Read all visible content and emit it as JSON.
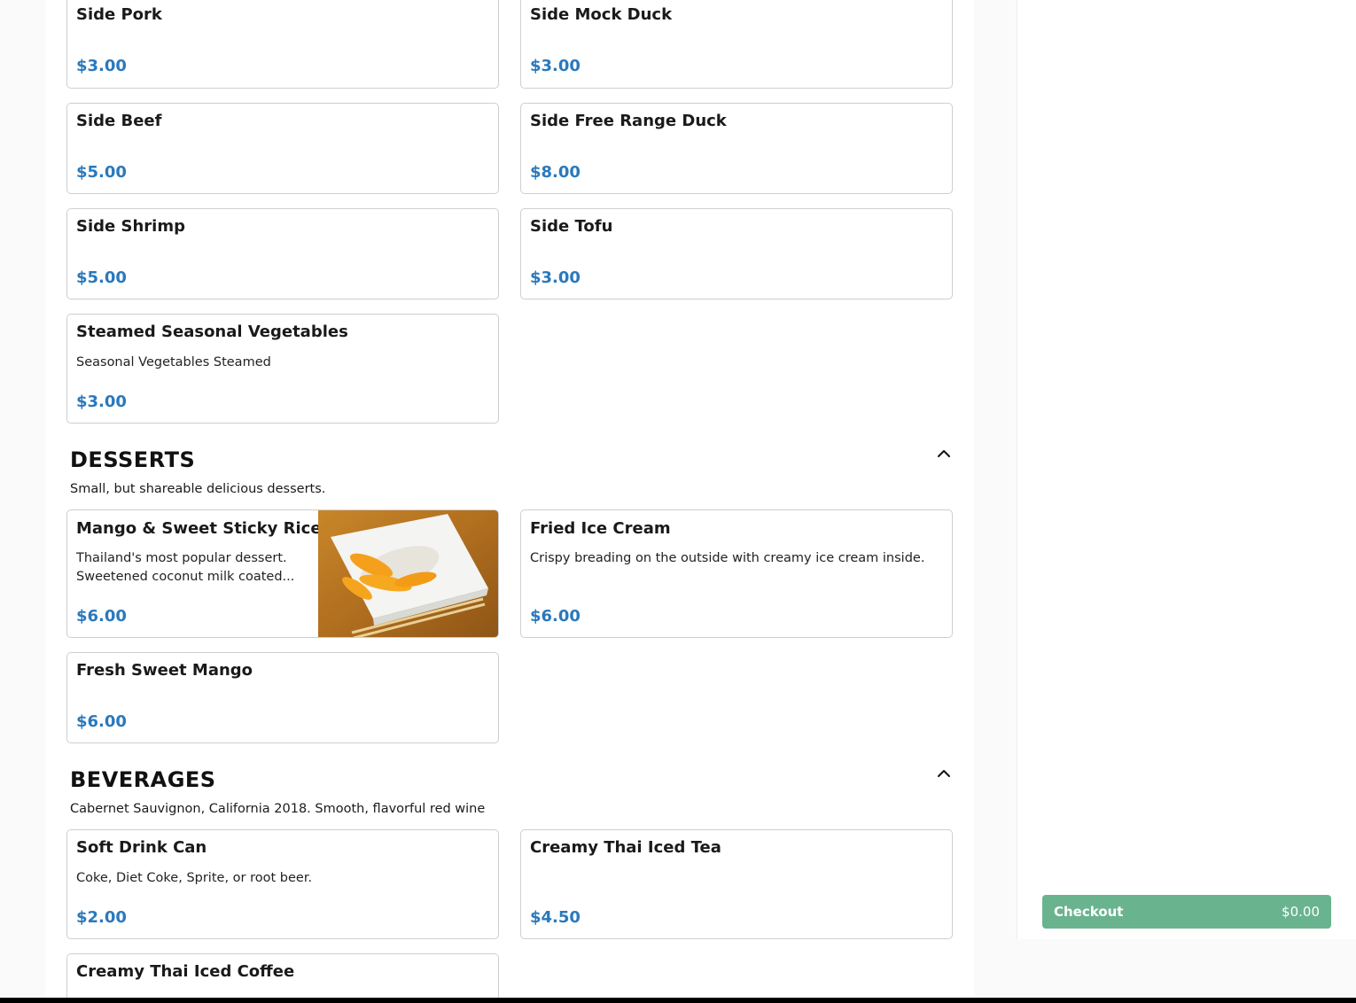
{
  "sides": [
    {
      "name": "Side Pork",
      "price": "$3.00"
    },
    {
      "name": "Side Mock Duck",
      "price": "$3.00"
    },
    {
      "name": "Side Beef",
      "price": "$5.00"
    },
    {
      "name": "Side Free Range Duck",
      "price": "$8.00"
    },
    {
      "name": "Side Shrimp",
      "price": "$5.00"
    },
    {
      "name": "Side Tofu",
      "price": "$3.00"
    },
    {
      "name": "Steamed Seasonal Vegetables",
      "description": "Seasonal Vegetables Steamed",
      "price": "$3.00"
    }
  ],
  "desserts": {
    "title": "DESSERTS",
    "subtitle": "Small, but shareable delicious desserts.",
    "items": [
      {
        "name": "Mango & Sweet Sticky Rice",
        "description": "Thailand's most popular dessert. Sweetened coconut milk coated...",
        "price": "$6.00",
        "image": "mango-sticky-rice-photo"
      },
      {
        "name": "Fried Ice Cream",
        "description": "Crispy breading on the outside with creamy ice cream inside.",
        "price": "$6.00"
      },
      {
        "name": "Fresh Sweet Mango",
        "price": "$6.00"
      }
    ]
  },
  "beverages": {
    "title": "BEVERAGES",
    "subtitle": "Cabernet Sauvignon, California 2018. Smooth, flavorful red wine",
    "items": [
      {
        "name": "Soft Drink Can",
        "description": "Coke, Diet Coke, Sprite, or root beer.",
        "price": "$2.00"
      },
      {
        "name": "Creamy Thai Iced Tea",
        "price": "$4.50"
      },
      {
        "name": "Creamy Thai Iced Coffee"
      }
    ]
  },
  "cart": {
    "checkout_label": "Checkout",
    "checkout_total": "$0.00"
  },
  "colors": {
    "price": "#2a79bd",
    "checkout": "#6ab38f"
  },
  "icons": {
    "collapse": "chevron-up-icon"
  }
}
